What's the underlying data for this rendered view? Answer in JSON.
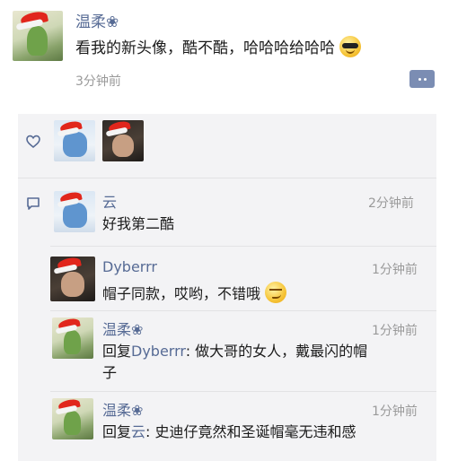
{
  "post": {
    "author": "温柔❀",
    "text": "看我的新头像，酷不酷，哈哈哈给哈哈",
    "time": "3分钟前"
  },
  "likes": {
    "users": [
      "Stitch-avatar",
      "Dyberrr-avatar"
    ]
  },
  "comments": [
    {
      "author": "云",
      "text": "好我第二酷",
      "time": "2分钟前"
    },
    {
      "author": "Dyberrr",
      "text": "帽子同款，哎哟，不错哦",
      "time": "1分钟前"
    },
    {
      "author": "温柔❀",
      "reply_prefix": "回复",
      "reply_to": "Dyberrr",
      "text_line1": ": 做大哥的女人，戴最闪的帽",
      "text_line2": "子",
      "time": "1分钟前"
    },
    {
      "author": "温柔❀",
      "reply_prefix": "回复",
      "reply_to": "云",
      "text_line1": ": 史迪仔竟然和圣诞帽毫无违和感",
      "time": "1分钟前"
    }
  ],
  "colors": {
    "name_link": "#576b95",
    "panel_bg": "#f3f3f5",
    "time": "#9a9a9a"
  }
}
